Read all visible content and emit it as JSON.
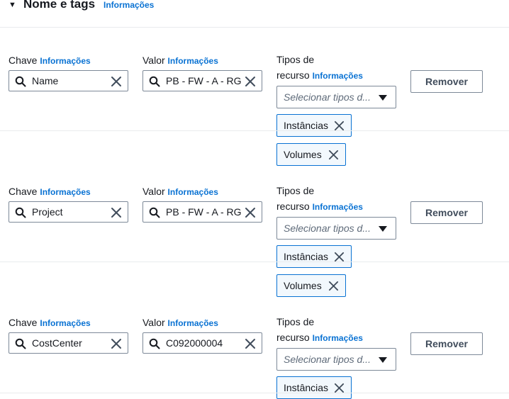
{
  "section": {
    "title": "Nome e tags",
    "info": "Informações"
  },
  "labels": {
    "key": "Chave",
    "value": "Valor",
    "types_line1": "Tipos de",
    "types_line2": "recurso",
    "info": "Informações",
    "select_placeholder": "Selecionar tipos d...",
    "remove": "Remover"
  },
  "icons": {
    "search": "search-icon",
    "clear": "close-icon",
    "dropdown": "caret-down-icon",
    "section_toggle": "caret-down-icon"
  },
  "rows": [
    {
      "key": "Name",
      "value": "PB - FW - A - RG",
      "tokens": [
        "Instâncias",
        "Volumes"
      ]
    },
    {
      "key": "Project",
      "value": "PB - FW - A - RG",
      "tokens": [
        "Instâncias",
        "Volumes"
      ]
    },
    {
      "key": "CostCenter",
      "value": "C092000004",
      "tokens": [
        "Instâncias"
      ]
    }
  ],
  "colors": {
    "link": "#0972d3",
    "token_bg": "#f2f8fd",
    "border": "#7d8998"
  }
}
